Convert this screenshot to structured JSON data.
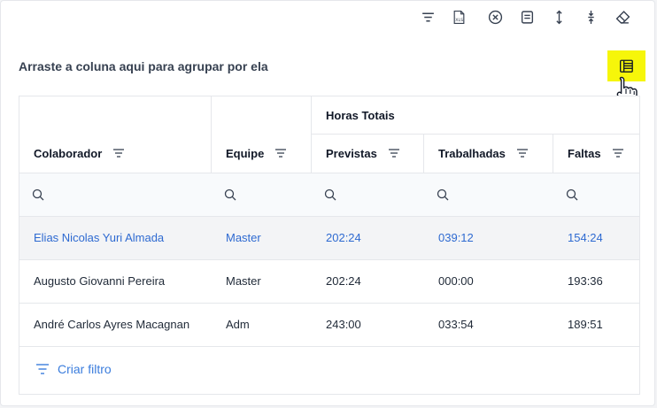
{
  "toolbar": {
    "icons": [
      "filter-icon",
      "export-xls-icon",
      "clear-circle-icon",
      "panel-icon",
      "expand-vertical-icon",
      "collapse-vertical-icon",
      "eraser-icon"
    ],
    "xls_text": "XLS"
  },
  "group_hint": "Arraste a coluna aqui para agrupar por ela",
  "column_chooser_icon": "column-chooser-icon",
  "grid": {
    "band_label": "Horas Totais",
    "columns": [
      "Colaborador",
      "Equipe",
      "Previstas",
      "Trabalhadas",
      "Faltas"
    ],
    "rows": [
      [
        "Elias Nicolas Yuri Almada",
        "Master",
        "202:24",
        "039:12",
        "154:24"
      ],
      [
        "Augusto Giovanni Pereira",
        "Master",
        "202:24",
        "000:00",
        "193:36"
      ],
      [
        "André Carlos Ayres Macagnan",
        "Adm",
        "243:00",
        "033:54",
        "189:51"
      ]
    ],
    "selected_row": 0
  },
  "footer": {
    "create_filter": "Criar filtro"
  },
  "colors": {
    "accent": "#2e6ad1",
    "highlight": "#f6f60a",
    "border": "#e5e7eb"
  }
}
